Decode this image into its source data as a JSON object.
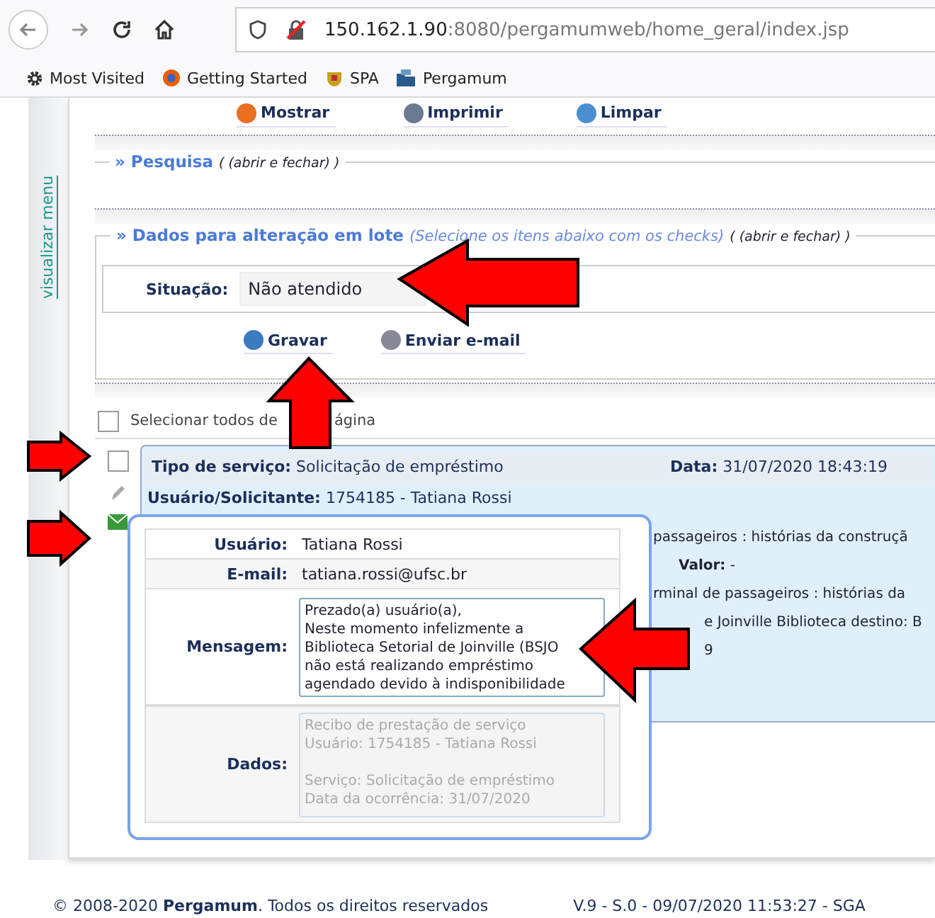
{
  "browser": {
    "url_host": "150.162.1.90",
    "url_path": ":8080/pergamumweb/home_geral/index.jsp",
    "bookmarks": [
      {
        "label": "Most Visited",
        "kind": "gear"
      },
      {
        "label": "Getting Started",
        "kind": "globe"
      },
      {
        "label": "SPA",
        "kind": "crest"
      },
      {
        "label": "Pergamum",
        "kind": "folder"
      }
    ]
  },
  "sidebar": {
    "label": "visualizar menu"
  },
  "toolbar": [
    {
      "label": "Mostrar",
      "kind": "show"
    },
    {
      "label": "Imprimir",
      "kind": "print"
    },
    {
      "label": "Limpar",
      "kind": "clear"
    }
  ],
  "search_section": {
    "title": "» Pesquisa",
    "toggle": "( (abrir e fechar) )"
  },
  "batch_section": {
    "title": "» Dados para alteração em lote",
    "hint": "(Selecione os itens abaixo com os checks)",
    "toggle": "( (abrir e fechar) )",
    "situation_label": "Situação:",
    "situation_value": "Não atendido",
    "buttons": [
      {
        "label": "Gravar",
        "kind": "save"
      },
      {
        "label": "Enviar e-mail",
        "kind": "email"
      }
    ]
  },
  "select_all": {
    "label_start": "Selecionar todos de",
    "label_end": "ágina",
    "checked": false
  },
  "record": {
    "checked": false,
    "service_label": "Tipo de serviço:",
    "service": "Solicitação de empréstimo",
    "date_label": "Data:",
    "date": "31/07/2020 18:43:19",
    "requester_label": "Usuário/Solicitante:",
    "requester": "1754185 - Tatiana Rossi",
    "lines": [
      {
        "kind": "text",
        "text": "passageiros : histórias da construçã"
      },
      {
        "kind": "field",
        "label": "Valor:",
        "text": "-"
      },
      {
        "kind": "text",
        "text": "rminal de passageiros : histórias da"
      },
      {
        "kind": "text",
        "text": "e Joinville Biblioteca destino: B"
      },
      {
        "kind": "text",
        "text": "9"
      }
    ]
  },
  "popup": {
    "user_label": "Usuário:",
    "user": "Tatiana Rossi",
    "email_label": "E-mail:",
    "email": "tatiana.rossi@ufsc.br",
    "message_label": "Mensagem:",
    "message": "Prezado(a) usuário(a),\nNeste momento infelizmente a\nBiblioteca Setorial de Joinville (BSJO\nnão está realizando empréstimo\nagendado devido à indisponibilidade",
    "data_label": "Dados:",
    "data": "Recibo de prestação de serviço\nUsuário: 1754185 - Tatiana Rossi\n\nServiço: Solicitação de empréstimo\nData da ocorrência: 31/07/2020"
  },
  "footer": {
    "copyright": "© 2008-2020  **Pergamum**. Todos os direitos reservados",
    "version": "V.9 - S.0 - 09/07/2020 11:53:27 - SGA"
  }
}
